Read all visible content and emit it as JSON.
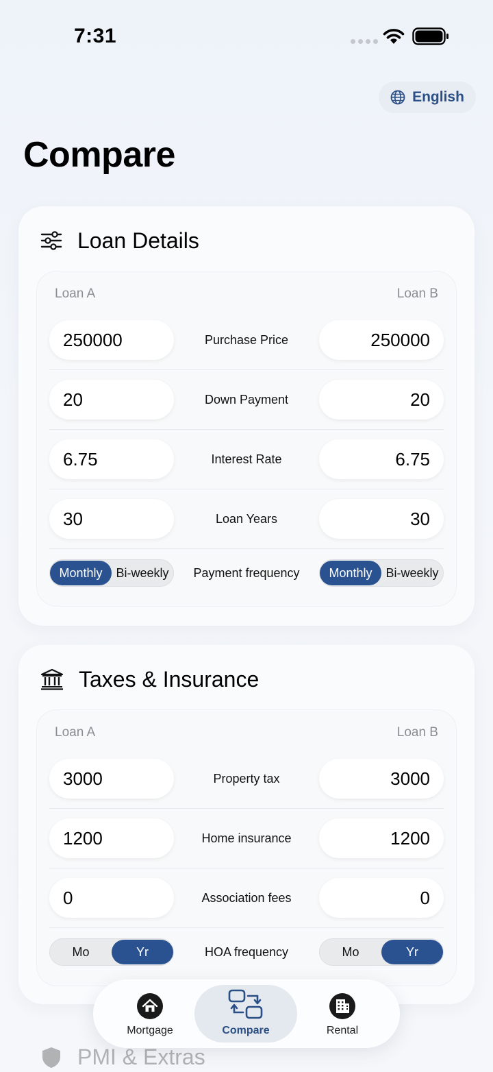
{
  "status": {
    "time": "7:31"
  },
  "language": {
    "label": "English"
  },
  "page": {
    "title": "Compare"
  },
  "loan_details": {
    "title": "Loan Details",
    "loan_a_label": "Loan A",
    "loan_b_label": "Loan B",
    "rows": [
      {
        "label": "Purchase Price",
        "a": "250000",
        "b": "250000"
      },
      {
        "label": "Down Payment",
        "a": "20",
        "b": "20"
      },
      {
        "label": "Interest Rate",
        "a": "6.75",
        "b": "6.75"
      },
      {
        "label": "Loan Years",
        "a": "30",
        "b": "30"
      }
    ],
    "frequency": {
      "label": "Payment frequency",
      "options": [
        "Monthly",
        "Bi-weekly"
      ],
      "a_selected": "Monthly",
      "b_selected": "Monthly"
    }
  },
  "taxes": {
    "title": "Taxes & Insurance",
    "loan_a_label": "Loan A",
    "loan_b_label": "Loan B",
    "rows": [
      {
        "label": "Property tax",
        "a": "3000",
        "b": "3000"
      },
      {
        "label": "Home insurance",
        "a": "1200",
        "b": "1200"
      },
      {
        "label": "Association fees",
        "a": "0",
        "b": "0"
      }
    ],
    "hoa": {
      "label": "HOA frequency",
      "options": [
        "Mo",
        "Yr"
      ],
      "a_selected": "Yr",
      "b_selected": "Yr"
    }
  },
  "pmi": {
    "title": "PMI & Extras"
  },
  "tabs": [
    {
      "label": "Mortgage",
      "icon": "house-icon",
      "active": false
    },
    {
      "label": "Compare",
      "icon": "compare-arrows-icon",
      "active": true
    },
    {
      "label": "Rental",
      "icon": "building-icon",
      "active": false
    }
  ],
  "colors": {
    "accent": "#2a5290",
    "accent_text": "#2a4f86"
  }
}
